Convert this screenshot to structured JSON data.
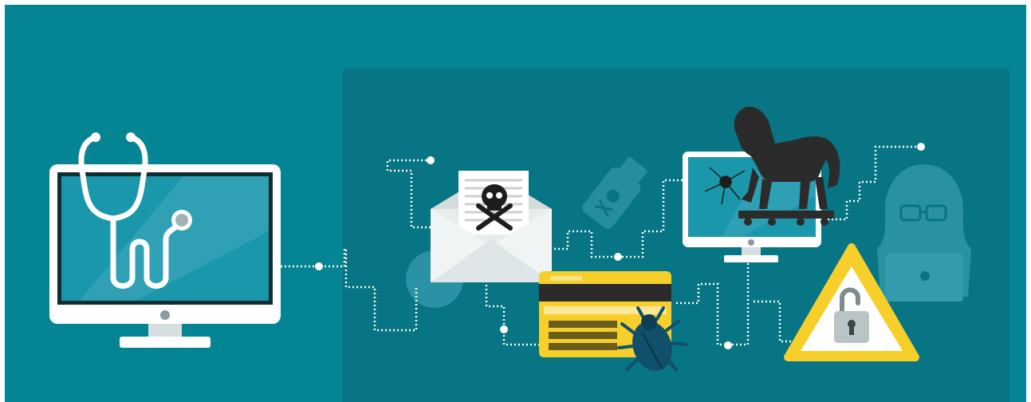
{
  "colors": {
    "background": "#058493",
    "panel": "#077583",
    "circuit_line": "#ffffff",
    "monitor_frame": "#ffffff",
    "monitor_screen": "#1b97ab",
    "screen_border": "#0f2d33",
    "danger_yellow": "#f6cf2b",
    "malware_dark": "#2b2b2b",
    "bug_blue": "#11506a",
    "faded_icon": "#2f96a7"
  },
  "illustration": {
    "elements": [
      "medical-monitor-with-stethoscope",
      "phishing-email-with-skull",
      "infected-usb-drive",
      "credit-card-with-bug",
      "trojan-horse-on-monitor",
      "hooded-hacker",
      "warning-sign-with-open-padlock",
      "circuit-network-lines"
    ]
  }
}
